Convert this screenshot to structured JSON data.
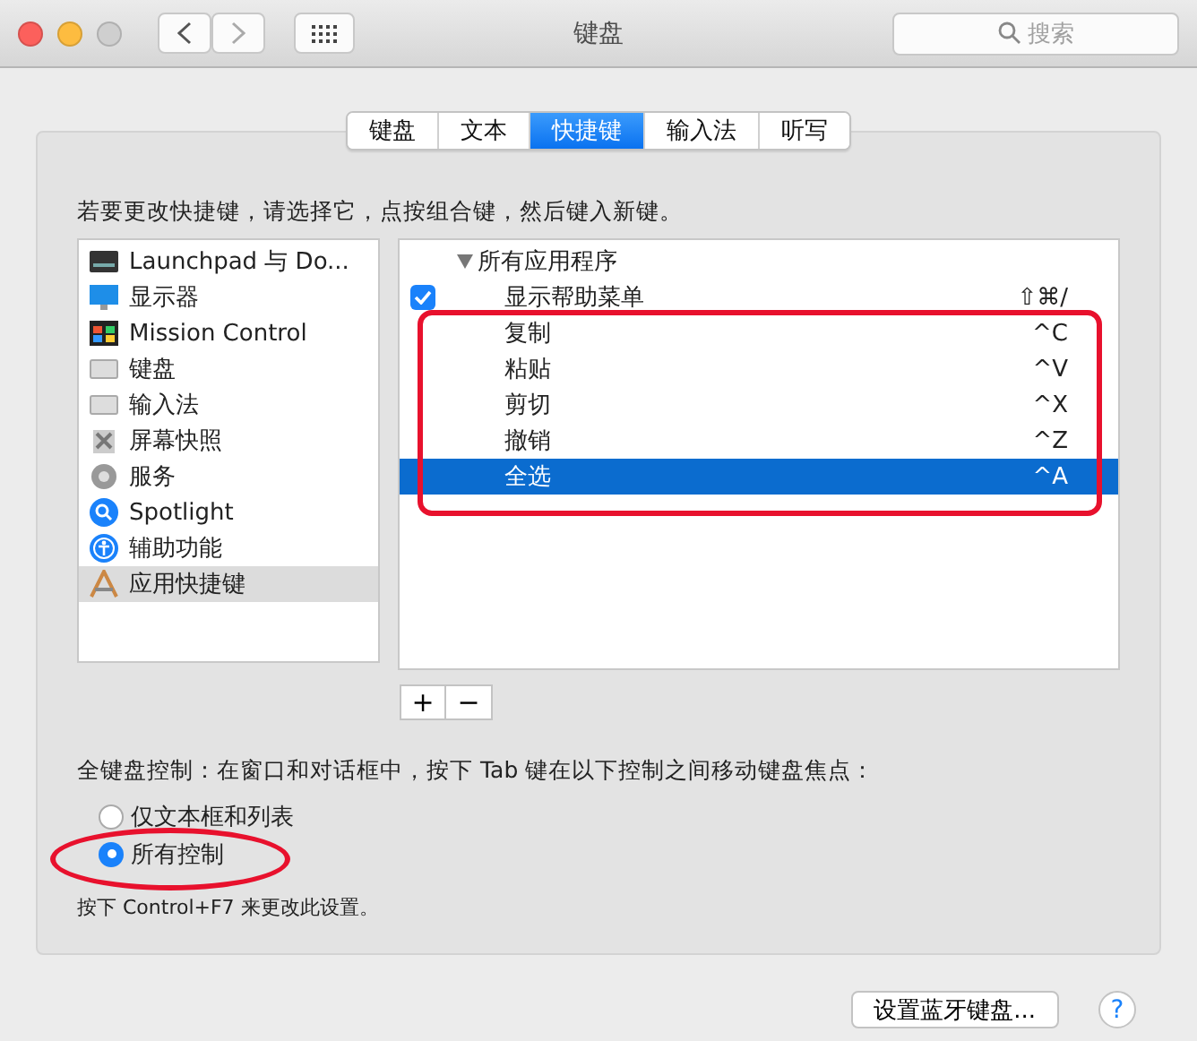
{
  "window": {
    "title": "键盘"
  },
  "search": {
    "placeholder": "搜索"
  },
  "tabs": [
    {
      "label": "键盘",
      "selected": false
    },
    {
      "label": "文本",
      "selected": false
    },
    {
      "label": "快捷键",
      "selected": true
    },
    {
      "label": "输入法",
      "selected": false
    },
    {
      "label": "听写",
      "selected": false
    }
  ],
  "instruction": "若要更改快捷键，请选择它，点按组合键，然后键入新键。",
  "categories": [
    {
      "label": "Launchpad 与 Do...",
      "selected": false
    },
    {
      "label": "显示器",
      "selected": false
    },
    {
      "label": "Mission Control",
      "selected": false
    },
    {
      "label": "键盘",
      "selected": false
    },
    {
      "label": "输入法",
      "selected": false
    },
    {
      "label": "屏幕快照",
      "selected": false
    },
    {
      "label": "服务",
      "selected": false
    },
    {
      "label": "Spotlight",
      "selected": false
    },
    {
      "label": "辅助功能",
      "selected": false
    },
    {
      "label": "应用快捷键",
      "selected": true
    }
  ],
  "shortcuts": {
    "group": {
      "label": "所有应用程序",
      "expanded": true
    },
    "rows": [
      {
        "name": "显示帮助菜单",
        "keys": "⇧⌘/",
        "checked": true,
        "selected": false
      },
      {
        "name": "复制",
        "keys": "^C",
        "selected": false
      },
      {
        "name": "粘贴",
        "keys": "^V",
        "selected": false
      },
      {
        "name": "剪切",
        "keys": "^X",
        "selected": false
      },
      {
        "name": "撤销",
        "keys": "^Z",
        "selected": false
      },
      {
        "name": "全选",
        "keys": "^A",
        "selected": true
      }
    ]
  },
  "list_buttons": [
    "+",
    "−"
  ],
  "full_keyboard_access": {
    "label": "全键盘控制：在窗口和对话框中，按下 Tab 键在以下控制之间移动键盘焦点：",
    "options": [
      {
        "label": "仅文本框和列表",
        "selected": false
      },
      {
        "label": "所有控制",
        "selected": true
      }
    ],
    "note": "按下 Control+F7 来更改此设置。"
  },
  "bluetooth_button": "设置蓝牙键盘...",
  "help_button": "?"
}
